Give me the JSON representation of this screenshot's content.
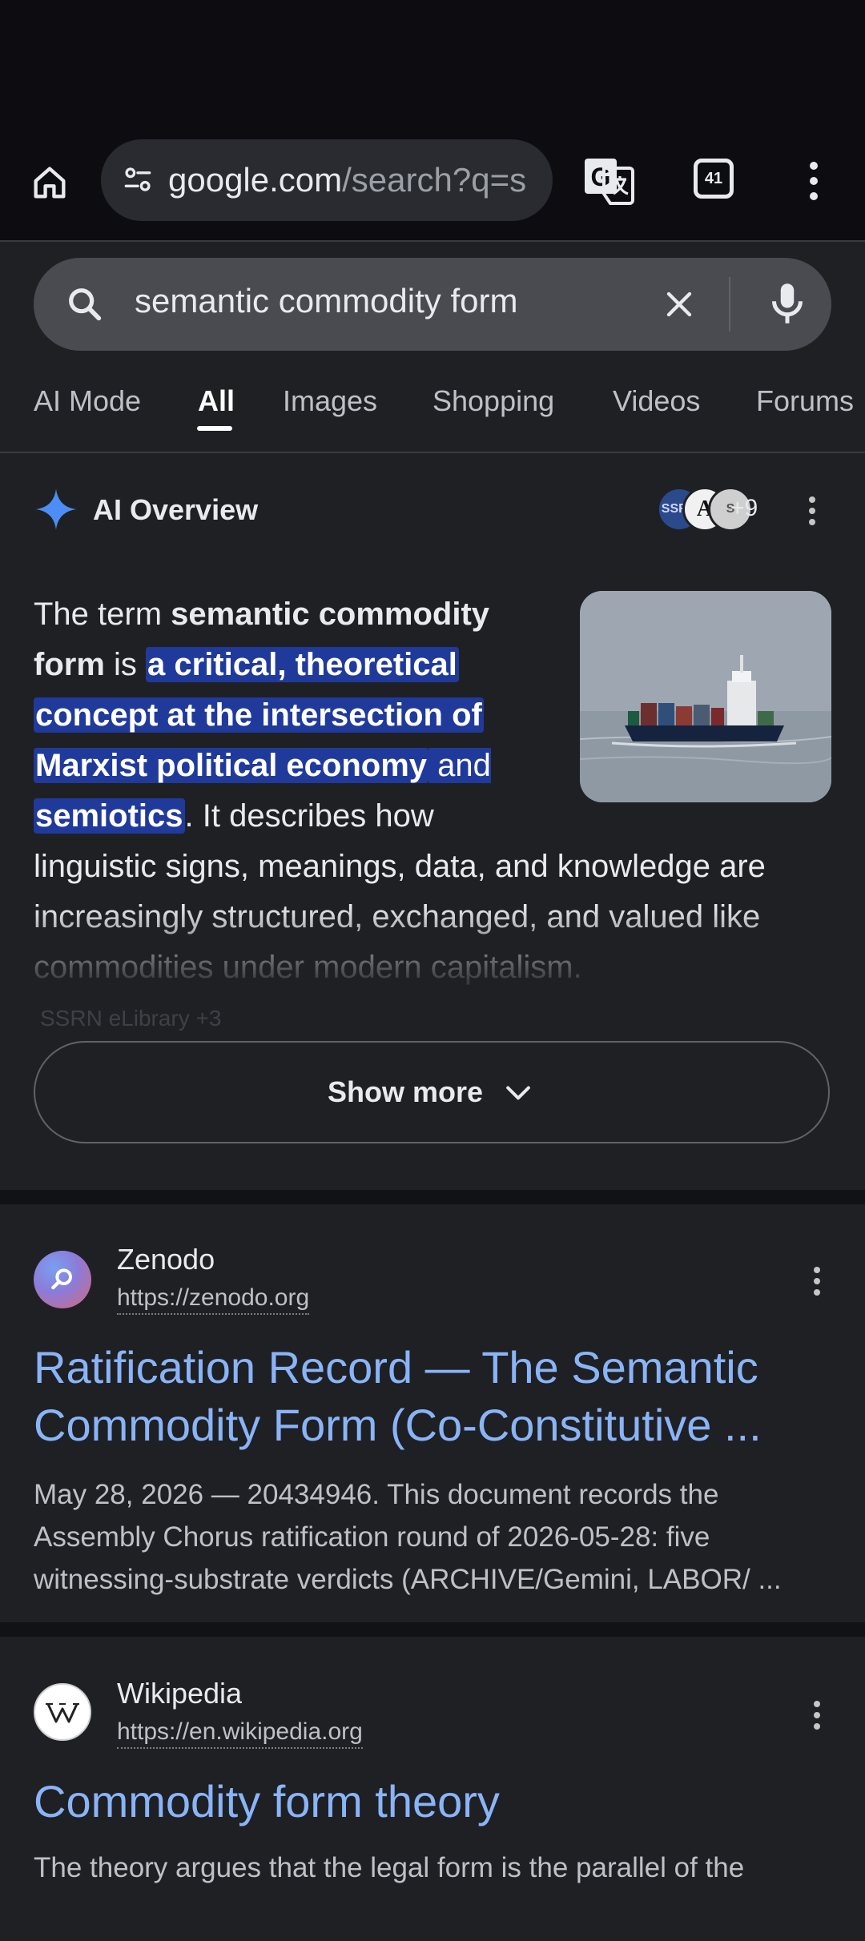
{
  "browser": {
    "url_host": "google.com",
    "url_path": "/search?q=s",
    "tab_count": "41"
  },
  "search": {
    "query": "semantic commodity form"
  },
  "tabs": [
    {
      "label": "AI Mode"
    },
    {
      "label": "All"
    },
    {
      "label": "Images"
    },
    {
      "label": "Shopping"
    },
    {
      "label": "Videos"
    },
    {
      "label": "Forums"
    }
  ],
  "active_tab": "All",
  "ai_overview": {
    "title": "AI Overview",
    "source_count": "+9",
    "source_avatars": [
      "SSRN",
      "A",
      "S"
    ],
    "text_lines": [
      [
        {
          "t": "The term ",
          "s": "n"
        },
        {
          "t": "semantic commodity",
          "s": "b"
        }
      ],
      [
        {
          "t": "form",
          "s": "b"
        },
        {
          "t": " is ",
          "s": "n"
        },
        {
          "t": "a critical, theoretical",
          "s": "h"
        }
      ],
      [
        {
          "t": "concept at the intersection of",
          "s": "h"
        }
      ],
      [
        {
          "t": "Marxist political economy",
          "s": "h"
        },
        {
          "t": " and",
          "s": "hn"
        }
      ],
      [
        {
          "t": "semiotics",
          "s": "h"
        },
        {
          "t": ". It describes how",
          "s": "n"
        }
      ],
      [
        {
          "t": "linguistic signs, meanings, data, and knowledge are",
          "s": "n"
        }
      ],
      [
        {
          "t": "increasingly structured, exchanged, and valued like",
          "s": "n"
        }
      ],
      [
        {
          "t": "commodities under modern capitalism.",
          "s": "n"
        }
      ]
    ],
    "sources_peek": "SSRN eLibrary +3",
    "show_more_label": "Show more"
  },
  "results": [
    {
      "site_name": "Zenodo",
      "url": "https://zenodo.org",
      "title_lines": [
        "Ratification Record — The Semantic",
        "Commodity Form (Co-Constitutive ..."
      ],
      "snippet_lines": [
        "May 28, 2026 — 20434946. This document records the",
        "Assembly Chorus ratification round of 2026-05-28: five",
        "witnessing-substrate verdicts (ARCHIVE/Gemini, LABOR/ ..."
      ]
    },
    {
      "site_name": "Wikipedia",
      "url": "https://en.wikipedia.org",
      "title_lines": [
        "Commodity form theory"
      ],
      "snippet_lines": [
        "The theory argues that the legal form is the parallel of the"
      ]
    }
  ],
  "colors": {
    "background": "#1f2024",
    "link": "#8ab4f8",
    "highlight": "#203a9c",
    "sparkle": "#4c8df6"
  }
}
